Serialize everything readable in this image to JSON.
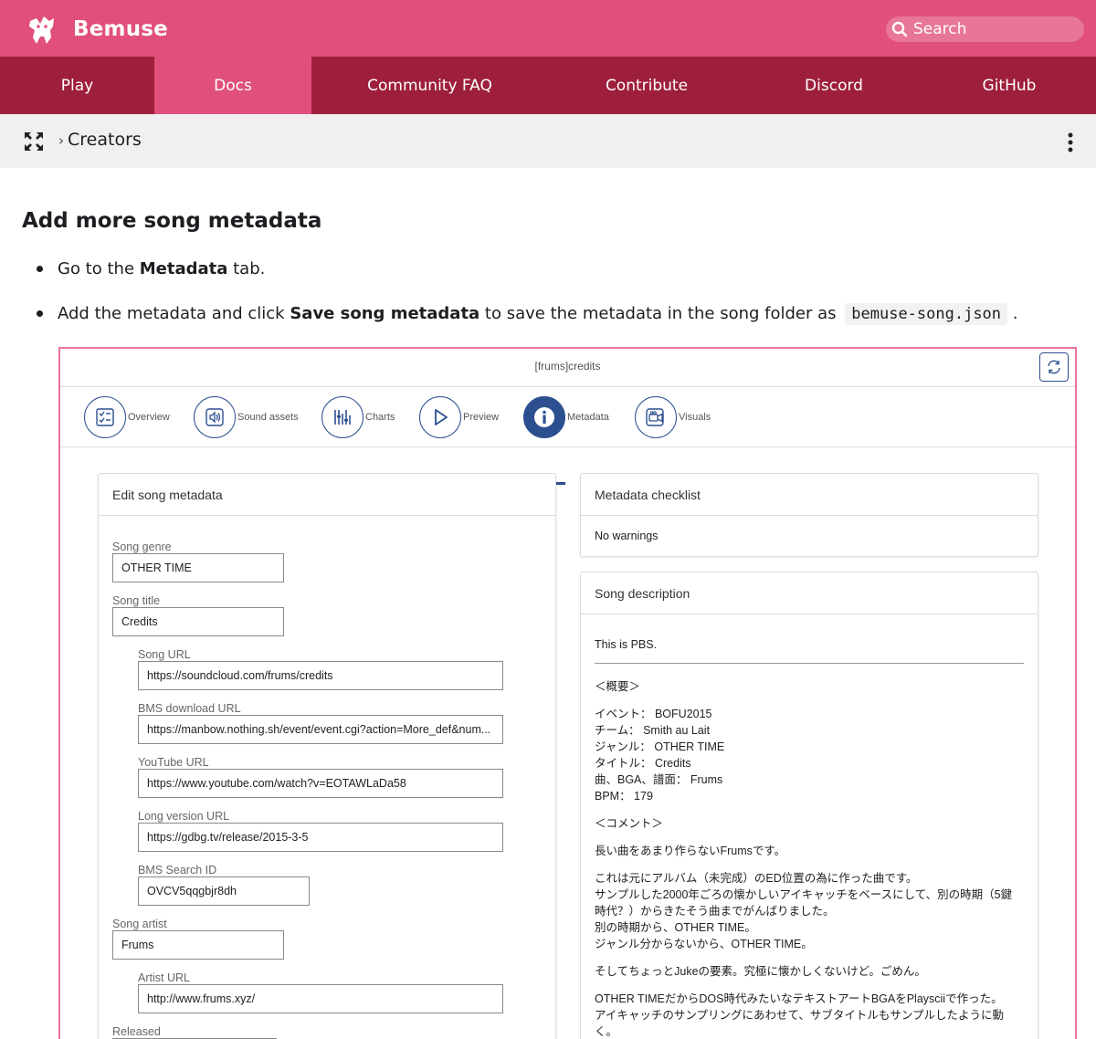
{
  "brand": {
    "name": "Bemuse"
  },
  "search": {
    "placeholder": "Search"
  },
  "nav": [
    {
      "label": "Play"
    },
    {
      "label": "Docs"
    },
    {
      "label": "Community FAQ"
    },
    {
      "label": "Contribute"
    },
    {
      "label": "Discord"
    },
    {
      "label": "GitHub"
    }
  ],
  "breadcrumb": {
    "separator": "›",
    "current": "Creators"
  },
  "article": {
    "heading": "Add more song metadata",
    "bullet1": {
      "pre": "Go to the ",
      "bold": "Metadata",
      "post": " tab."
    },
    "bullet2": {
      "pre": "Add the metadata and click ",
      "bold": "Save song metadata",
      "mid": " to save the metadata in the song folder as",
      "code": "bemuse-song.json",
      "post": "."
    }
  },
  "editor": {
    "title": "[frums]credits",
    "tabs": [
      {
        "label": "Overview",
        "icon": "checklist-icon"
      },
      {
        "label": "Sound assets",
        "icon": "speaker-icon"
      },
      {
        "label": "Charts",
        "icon": "chart-bars-icon"
      },
      {
        "label": "Preview",
        "icon": "play-icon"
      },
      {
        "label": "Metadata",
        "icon": "info-icon"
      },
      {
        "label": "Visuals",
        "icon": "video-icon"
      }
    ],
    "active_tab": "Metadata",
    "accent_color": "#2c4f8f",
    "edit_panel": {
      "title": "Edit song metadata",
      "fields": [
        {
          "label": "Song genre",
          "value": "OTHER TIME"
        },
        {
          "label": "Song title",
          "value": "Credits"
        },
        {
          "label": "Song URL",
          "value": "https://soundcloud.com/frums/credits"
        },
        {
          "label": "BMS download URL",
          "value": "https://manbow.nothing.sh/event/event.cgi?action=More_def&num..."
        },
        {
          "label": "YouTube URL",
          "value": "https://www.youtube.com/watch?v=EOTAWLaDa58"
        },
        {
          "label": "Long version URL",
          "value": "https://gdbg.tv/release/2015-3-5"
        },
        {
          "label": "BMS Search ID",
          "value": "OVCV5qqgbjr8dh"
        },
        {
          "label": "Song artist",
          "value": "Frums"
        },
        {
          "label": "Artist URL",
          "value": "http://www.frums.xyz/"
        },
        {
          "label": "Released",
          "value": ""
        }
      ]
    },
    "checklist": {
      "title": "Metadata checklist",
      "status": "No warnings"
    },
    "description": {
      "title": "Song description",
      "first_line": "This is PBS.",
      "paragraphs": [
        [
          "＜概要＞"
        ],
        [
          "イベント： BOFU2015",
          "チーム： Smith au Lait",
          "ジャンル： OTHER TIME",
          "タイトル： Credits",
          "曲、BGA、譜面： Frums",
          "BPM： 179"
        ],
        [
          "＜コメント＞"
        ],
        [
          "長い曲をあまり作らないFrumsです。"
        ],
        [
          "これは元にアルバム（未完成）のED位置の為に作った曲です。",
          "サンプルした2000年ごろの懐かしいアイキャッチをベースにして、別の時期（5鍵",
          "時代？）からきたそう曲までがんばりました。",
          "別の時期から、OTHER TIME。",
          "ジャンル分からないから、OTHER TIME。"
        ],
        [
          "そしてちょっとJukeの要素。究極に懐かしくないけど。ごめん。"
        ],
        [
          "OTHER TIMEだからDOS時代みたいなテキストアートBGAをPlaysciiで作った。",
          "アイキャッチのサンプリングにあわせて、サブタイトルもサンプルしたように動",
          "く。"
        ]
      ]
    }
  }
}
